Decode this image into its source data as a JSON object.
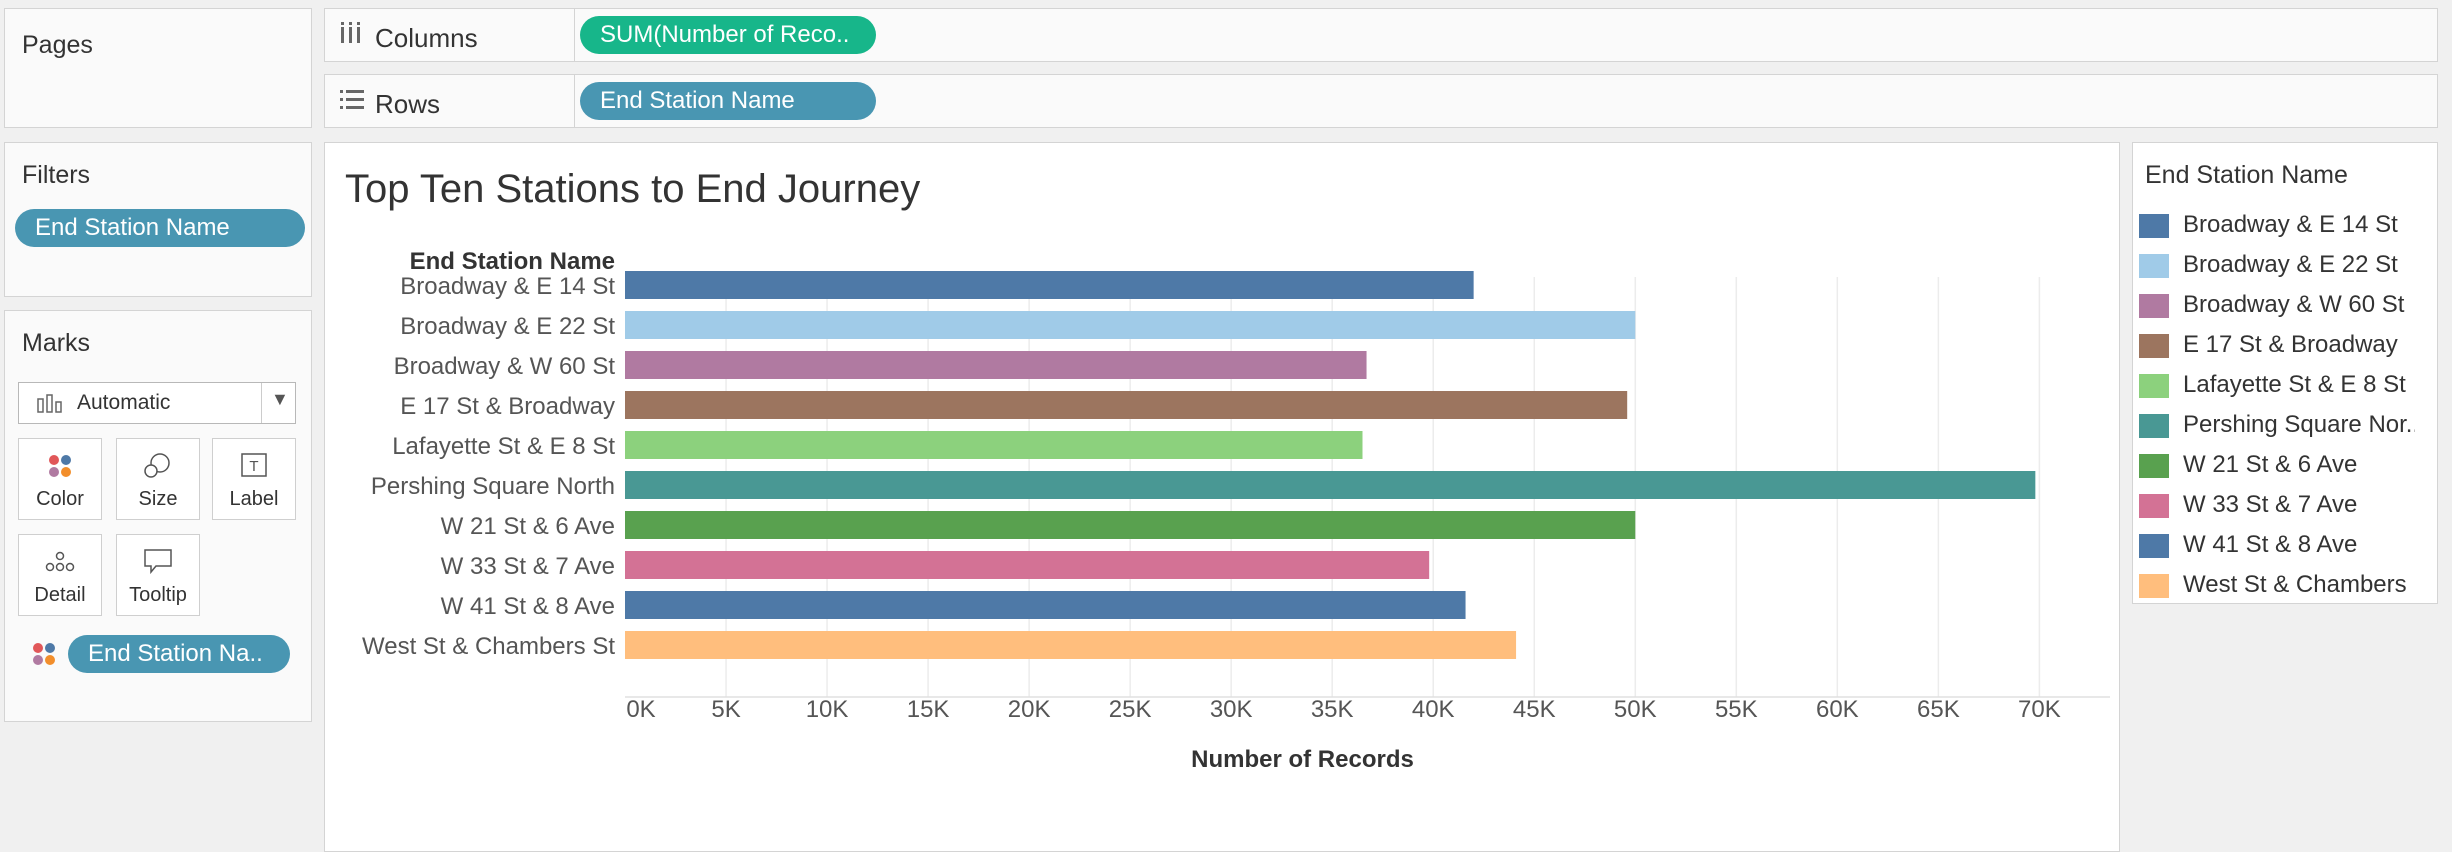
{
  "pages": {
    "title": "Pages"
  },
  "shelves": {
    "columns": {
      "label": "Columns",
      "pill": "SUM(Number of Reco.."
    },
    "rows": {
      "label": "Rows",
      "pill": "End Station Name"
    }
  },
  "filters": {
    "title": "Filters",
    "pill": "End Station Name"
  },
  "marks": {
    "title": "Marks",
    "mark_type": "Automatic",
    "buttons": {
      "color": "Color",
      "size": "Size",
      "label": "Label",
      "detail": "Detail",
      "tooltip": "Tooltip"
    },
    "color_pill": "End Station Na.."
  },
  "legend": {
    "title": "End Station Name",
    "items": [
      {
        "label": "Broadway & E 14 St",
        "color": "#4e79a7"
      },
      {
        "label": "Broadway & E 22 St",
        "color": "#a0cbe8"
      },
      {
        "label": "Broadway & W 60 St",
        "color": "#b07aa1"
      },
      {
        "label": "E 17 St & Broadway",
        "color": "#9c755f"
      },
      {
        "label": "Lafayette St & E 8 St",
        "color": "#8cd17d"
      },
      {
        "label": "Pershing Square Nor..",
        "color": "#499894"
      },
      {
        "label": "W 21 St & 6 Ave",
        "color": "#59a14f"
      },
      {
        "label": "W 33 St & 7 Ave",
        "color": "#d37295"
      },
      {
        "label": "W 41 St & 8 Ave",
        "color": "#4e79a7"
      },
      {
        "label": "West St & Chambers ..",
        "color": "#ffbe7d"
      }
    ]
  },
  "chart_data": {
    "type": "bar",
    "orientation": "horizontal",
    "title": "Top Ten Stations to End Journey",
    "row_header": "End Station Name",
    "xlabel": "Number of Records",
    "categories": [
      "Broadway & E 14 St",
      "Broadway & E 22 St",
      "Broadway & W 60 St",
      "E 17 St & Broadway",
      "Lafayette St & E 8 St",
      "Pershing Square North",
      "W 21 St & 6 Ave",
      "W 33 St & 7 Ave",
      "W 41 St & 8 Ave",
      "West St & Chambers St"
    ],
    "values": [
      42000,
      50000,
      36700,
      49600,
      36500,
      69800,
      50000,
      39800,
      41600,
      44100
    ],
    "colors": [
      "#4e79a7",
      "#a0cbe8",
      "#b07aa1",
      "#9c755f",
      "#8cd17d",
      "#499894",
      "#59a14f",
      "#d37295",
      "#4e79a7",
      "#ffbe7d"
    ],
    "xlim": [
      0,
      73000
    ],
    "xticks": [
      0,
      5000,
      10000,
      15000,
      20000,
      25000,
      30000,
      35000,
      40000,
      45000,
      50000,
      55000,
      60000,
      65000,
      70000
    ],
    "xtick_labels": [
      "0K",
      "5K",
      "10K",
      "15K",
      "20K",
      "25K",
      "30K",
      "35K",
      "40K",
      "45K",
      "50K",
      "55K",
      "60K",
      "65K",
      "70K"
    ],
    "grid": true
  }
}
